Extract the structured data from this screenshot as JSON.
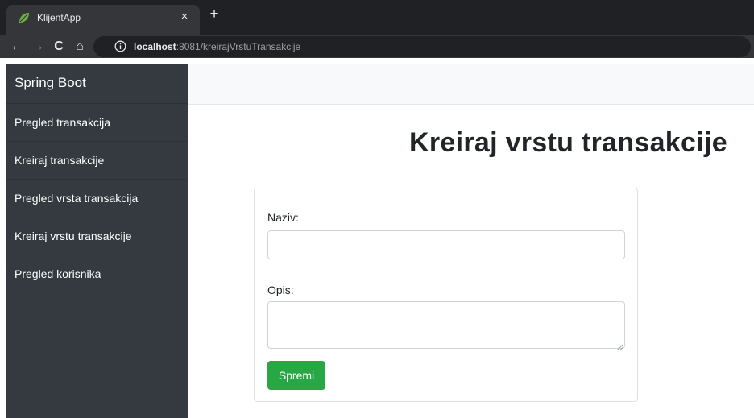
{
  "browser": {
    "tab_title": "KlijentApp",
    "tab_close": "×",
    "new_tab": "+",
    "url_host": "localhost",
    "url_rest": ":8081/kreirajVrstuTransakcije",
    "nav": {
      "back": "←",
      "forward": "→",
      "reload": "C",
      "home": "⌂"
    }
  },
  "sidebar": {
    "brand": "Spring Boot",
    "items": [
      {
        "label": "Pregled transakcija"
      },
      {
        "label": "Kreiraj transakcije"
      },
      {
        "label": "Pregled vrsta transakcija"
      },
      {
        "label": "Kreiraj vrstu transakcije"
      },
      {
        "label": "Pregled korisnika"
      }
    ]
  },
  "main": {
    "title": "Kreiraj vrstu transakcije",
    "form": {
      "naziv_label": "Naziv:",
      "naziv_value": "",
      "opis_label": "Opis:",
      "opis_value": "",
      "submit_label": "Spremi"
    }
  },
  "colors": {
    "sidebar_bg": "#343a40",
    "topbar_bg": "#f8f9fa",
    "button_green": "#28a745",
    "chrome_dark": "#202124",
    "chrome_tab": "#35363a"
  },
  "icons": [
    "spring-leaf-icon",
    "close-icon",
    "plus-icon",
    "back-arrow-icon",
    "forward-arrow-icon",
    "reload-icon",
    "home-icon",
    "info-icon"
  ]
}
